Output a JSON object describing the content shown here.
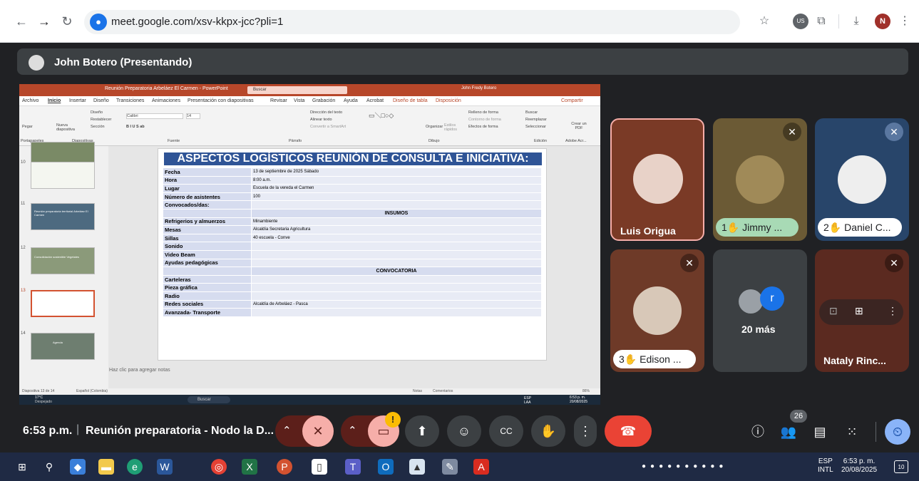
{
  "browser": {
    "url": "meet.google.com/xsv-kkpx-jcc?pli=1",
    "profile_initial": "N",
    "icons": [
      "back-icon",
      "forward-icon",
      "reload-icon",
      "site-info-icon",
      "bookmark-star-icon",
      "extension-us-icon",
      "extensions-puzzle-icon",
      "download-icon",
      "more-vert-icon"
    ],
    "extension_badge": "US"
  },
  "presenter": {
    "label": "John Botero (Presentando)"
  },
  "ppt": {
    "window_title": "Reunión Preparatoria Arbeláez El Carmen - PowerPoint",
    "search": "Buscar",
    "user": "John Fredy Botero",
    "menu": [
      "Archivo",
      "Inicio",
      "Insertar",
      "Diseño",
      "Transiciones",
      "Animaciones",
      "Presentación con diapositivas",
      "Revisar",
      "Vista",
      "Grabación",
      "Ayuda",
      "Acrobat",
      "Diseño de tabla",
      "Disposición"
    ],
    "share_label": "Compartir",
    "ribbon": {
      "paste": "Pegar",
      "new_slide": "Nueva diapositiva",
      "layout": "Diseño",
      "reset": "Restablecer",
      "section": "Sección",
      "font": "Calibri",
      "font_size": "14",
      "text_direction": "Dirección del texto",
      "align_text": "Alinear texto",
      "convert_smartart": "Convertir a SmartArt",
      "organize": "Organizar",
      "quick_styles": "Estilos rápidos",
      "shape_fill": "Relleno de forma",
      "shape_outline": "Contorno de forma",
      "shape_effects": "Efectos de forma",
      "find": "Buscar",
      "replace": "Reemplazar",
      "select": "Seleccionar",
      "create_pdf": "Crear un PDF",
      "groups": [
        "Portapapeles",
        "Diapositivas",
        "Fuente",
        "Párrafo",
        "Dibujo",
        "Edición",
        "Adobe Acr..."
      ]
    },
    "thumb_numbers": [
      "10",
      "11",
      "12",
      "13",
      "14"
    ],
    "thumb_texts": [
      "",
      "Reunión preparatoria territorial Arbeláez El Carmen",
      "Consolidación sostenible Vegetales",
      "",
      "Agenda"
    ],
    "slide": {
      "title": "ASPECTOS LOGÍSTICOS REUNIÓN DE CONSULTA E INICIATIVA:",
      "rows": [
        {
          "k": "Fecha",
          "v": "13 de septiembre de 2025 Sábado"
        },
        {
          "k": "Hora",
          "v": "8:00 a.m."
        },
        {
          "k": "Lugar",
          "v": "Escuela de la vereda el Carmen"
        },
        {
          "k": "Número de asistentes",
          "v": "100"
        },
        {
          "k": "Convocados/das:",
          "v": ""
        }
      ],
      "section1": "INSUMOS",
      "rows2": [
        {
          "k": "Refrigerios y almuerzos",
          "v": "Minambiente"
        },
        {
          "k": "Mesas",
          "v": "Alcaldía Secretaria Agricultura"
        },
        {
          "k": "Sillas",
          "v": "40 escuela - Conve"
        },
        {
          "k": "Sonido",
          "v": ""
        },
        {
          "k": "Video Beam",
          "v": ""
        },
        {
          "k": "Ayudas pedagógicas",
          "v": ""
        }
      ],
      "section2": "CONVOCATORIA",
      "rows3": [
        {
          "k": "Carteleras",
          "v": ""
        },
        {
          "k": "Pieza gráfica",
          "v": ""
        },
        {
          "k": "Radio",
          "v": ""
        },
        {
          "k": "Redes sociales",
          "v": "Alcaldía de Arbeláez - Pasca"
        },
        {
          "k": "Avanzada- Transporte",
          "v": ""
        }
      ]
    },
    "notes_placeholder": "Haz clic para agregar notas",
    "status_left": "Diapositiva 13 de 14",
    "status_lang": "Español (Colombia)",
    "status_notes": "Notas",
    "status_comments": "Comentarios",
    "status_zoom": "86%",
    "inner_taskbar": {
      "weather_temp": "17°C",
      "weather_desc": "Despejado",
      "search": "Buscar",
      "lang": "ESP LAA",
      "time": "6:53 p. m.",
      "date": "20/08/2025"
    }
  },
  "participants": [
    {
      "name": "Luis Origua",
      "muted": false,
      "hand": false,
      "hand_order": ""
    },
    {
      "name": "Jimmy ...",
      "muted": true,
      "hand": true,
      "hand_order": "1"
    },
    {
      "name": "Daniel C...",
      "muted": true,
      "hand": true,
      "hand_order": "2"
    },
    {
      "name": "Edison ...",
      "muted": true,
      "hand": true,
      "hand_order": "3"
    },
    {
      "name": "20 más",
      "muted": false,
      "hand": false,
      "hand_order": ""
    },
    {
      "name": "Nataly Rinc...",
      "muted": true,
      "hand": false,
      "hand_order": ""
    }
  ],
  "more_tile_initial": "r",
  "colors": {
    "meet_bg": "#202124",
    "tile_luis": "#7a3a26",
    "tile_jimmy": "#6b5a35",
    "tile_daniel": "#28456a",
    "tile_edison": "#6e3a28",
    "tile_more": "#3c4043",
    "tile_nataly": "#5b2a20",
    "end_call": "#ea4335",
    "pill_green": "#a8dab5",
    "accent_blue": "#8ab4f8"
  },
  "meeting": {
    "time": "6:53 p.m.",
    "separator": "|",
    "name": "Reunión preparatoria - Nodo la D...",
    "participants_count": "26",
    "warning_badge": "!"
  },
  "controls": [
    "chevron-up-icon",
    "mic-off-icon",
    "chevron-up-icon",
    "camera-off-icon",
    "present-icon",
    "emoji-icon",
    "captions-icon",
    "raise-hand-icon",
    "more-options-icon",
    "end-call-icon"
  ],
  "right_controls": [
    "info-icon",
    "people-icon",
    "chat-icon",
    "activities-icon",
    "host-controls-icon"
  ],
  "taskbar": {
    "lang_line1": "ESP",
    "lang_line2": "INTL",
    "time": "6:53 p. m.",
    "date": "20/08/2025",
    "notif_count": "10",
    "apps": [
      "windows-start-icon",
      "search-icon",
      "copilot-icon",
      "file-explorer-icon",
      "edge-icon",
      "word-icon",
      "chrome-icon",
      "excel-icon",
      "powerpoint-icon",
      "notepad-icon",
      "teams-icon",
      "outlook-icon",
      "photos-icon",
      "paint-icon",
      "acrobat-icon"
    ]
  }
}
